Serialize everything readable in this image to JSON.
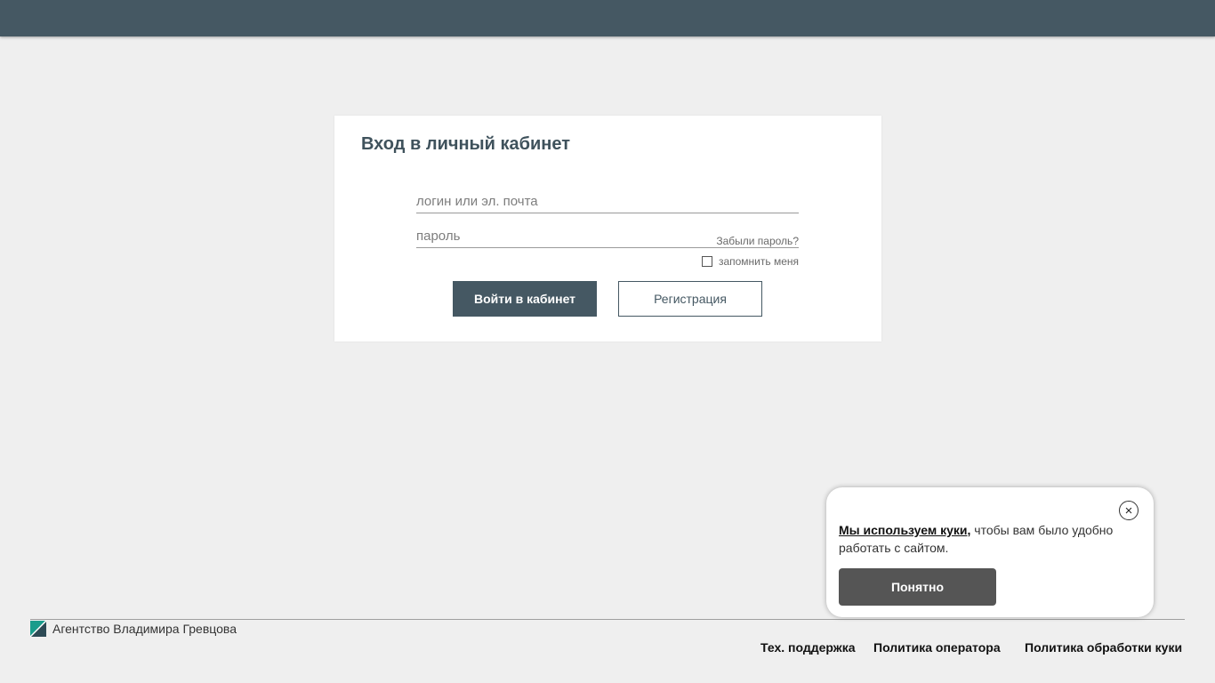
{
  "login": {
    "title": "Вход в личный кабинет",
    "login_placeholder": "логин или эл. почта",
    "password_placeholder": "пароль",
    "forgot_label": "Забыли пароль?",
    "remember_label": "запомнить меня",
    "submit_label": "Войти в кабинет",
    "register_label": "Регистрация"
  },
  "cookie": {
    "link_text": "Мы используем куки,",
    "rest_text": " чтобы вам было удобно работать с сайтом.",
    "accept_label": "Понятно",
    "close_symbol": "×"
  },
  "footer": {
    "brand": "Агентство Владимира Гревцова",
    "links": [
      "Тех. поддержка",
      "Политика оператора",
      "Политика обработки куки"
    ]
  },
  "colors": {
    "header": "#455863",
    "background": "#efefef",
    "logo_teal": "#1a9c8c",
    "logo_dark": "#2d4a55"
  }
}
